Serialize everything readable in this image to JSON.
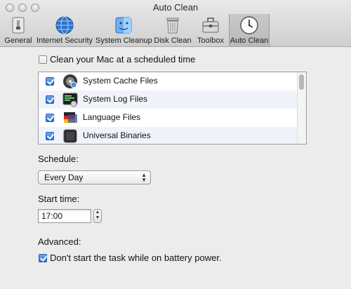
{
  "window": {
    "title": "Auto Clean"
  },
  "toolbar": {
    "items": [
      {
        "label": "General",
        "icon": "switch-icon"
      },
      {
        "label": "Internet Security",
        "icon": "globe-icon"
      },
      {
        "label": "System Cleanup",
        "icon": "finder-icon"
      },
      {
        "label": "Disk Clean",
        "icon": "trash-icon"
      },
      {
        "label": "Toolbox",
        "icon": "toolbox-icon"
      },
      {
        "label": "Auto Clean",
        "icon": "clock-icon",
        "active": true
      }
    ]
  },
  "main": {
    "scheduled_label": "Clean your Mac at a scheduled time",
    "scheduled_checked": false,
    "items": [
      {
        "label": "System Cache Files",
        "checked": true,
        "icon": "cache-icon"
      },
      {
        "label": "System Log Files",
        "checked": true,
        "icon": "console-log-icon"
      },
      {
        "label": "Language Files",
        "checked": true,
        "icon": "language-flags-icon"
      },
      {
        "label": "Universal Binaries",
        "checked": true,
        "icon": "binary-icon"
      }
    ],
    "schedule_label": "Schedule:",
    "schedule_value": "Every Day",
    "start_time_label": "Start time:",
    "start_time_value": "17:00",
    "advanced_label": "Advanced:",
    "battery_label": "Don't start the task while on battery power.",
    "battery_checked": true
  },
  "colors": {
    "accent": "#2f6fd0",
    "toolbar_active": "#bdbdbd"
  }
}
